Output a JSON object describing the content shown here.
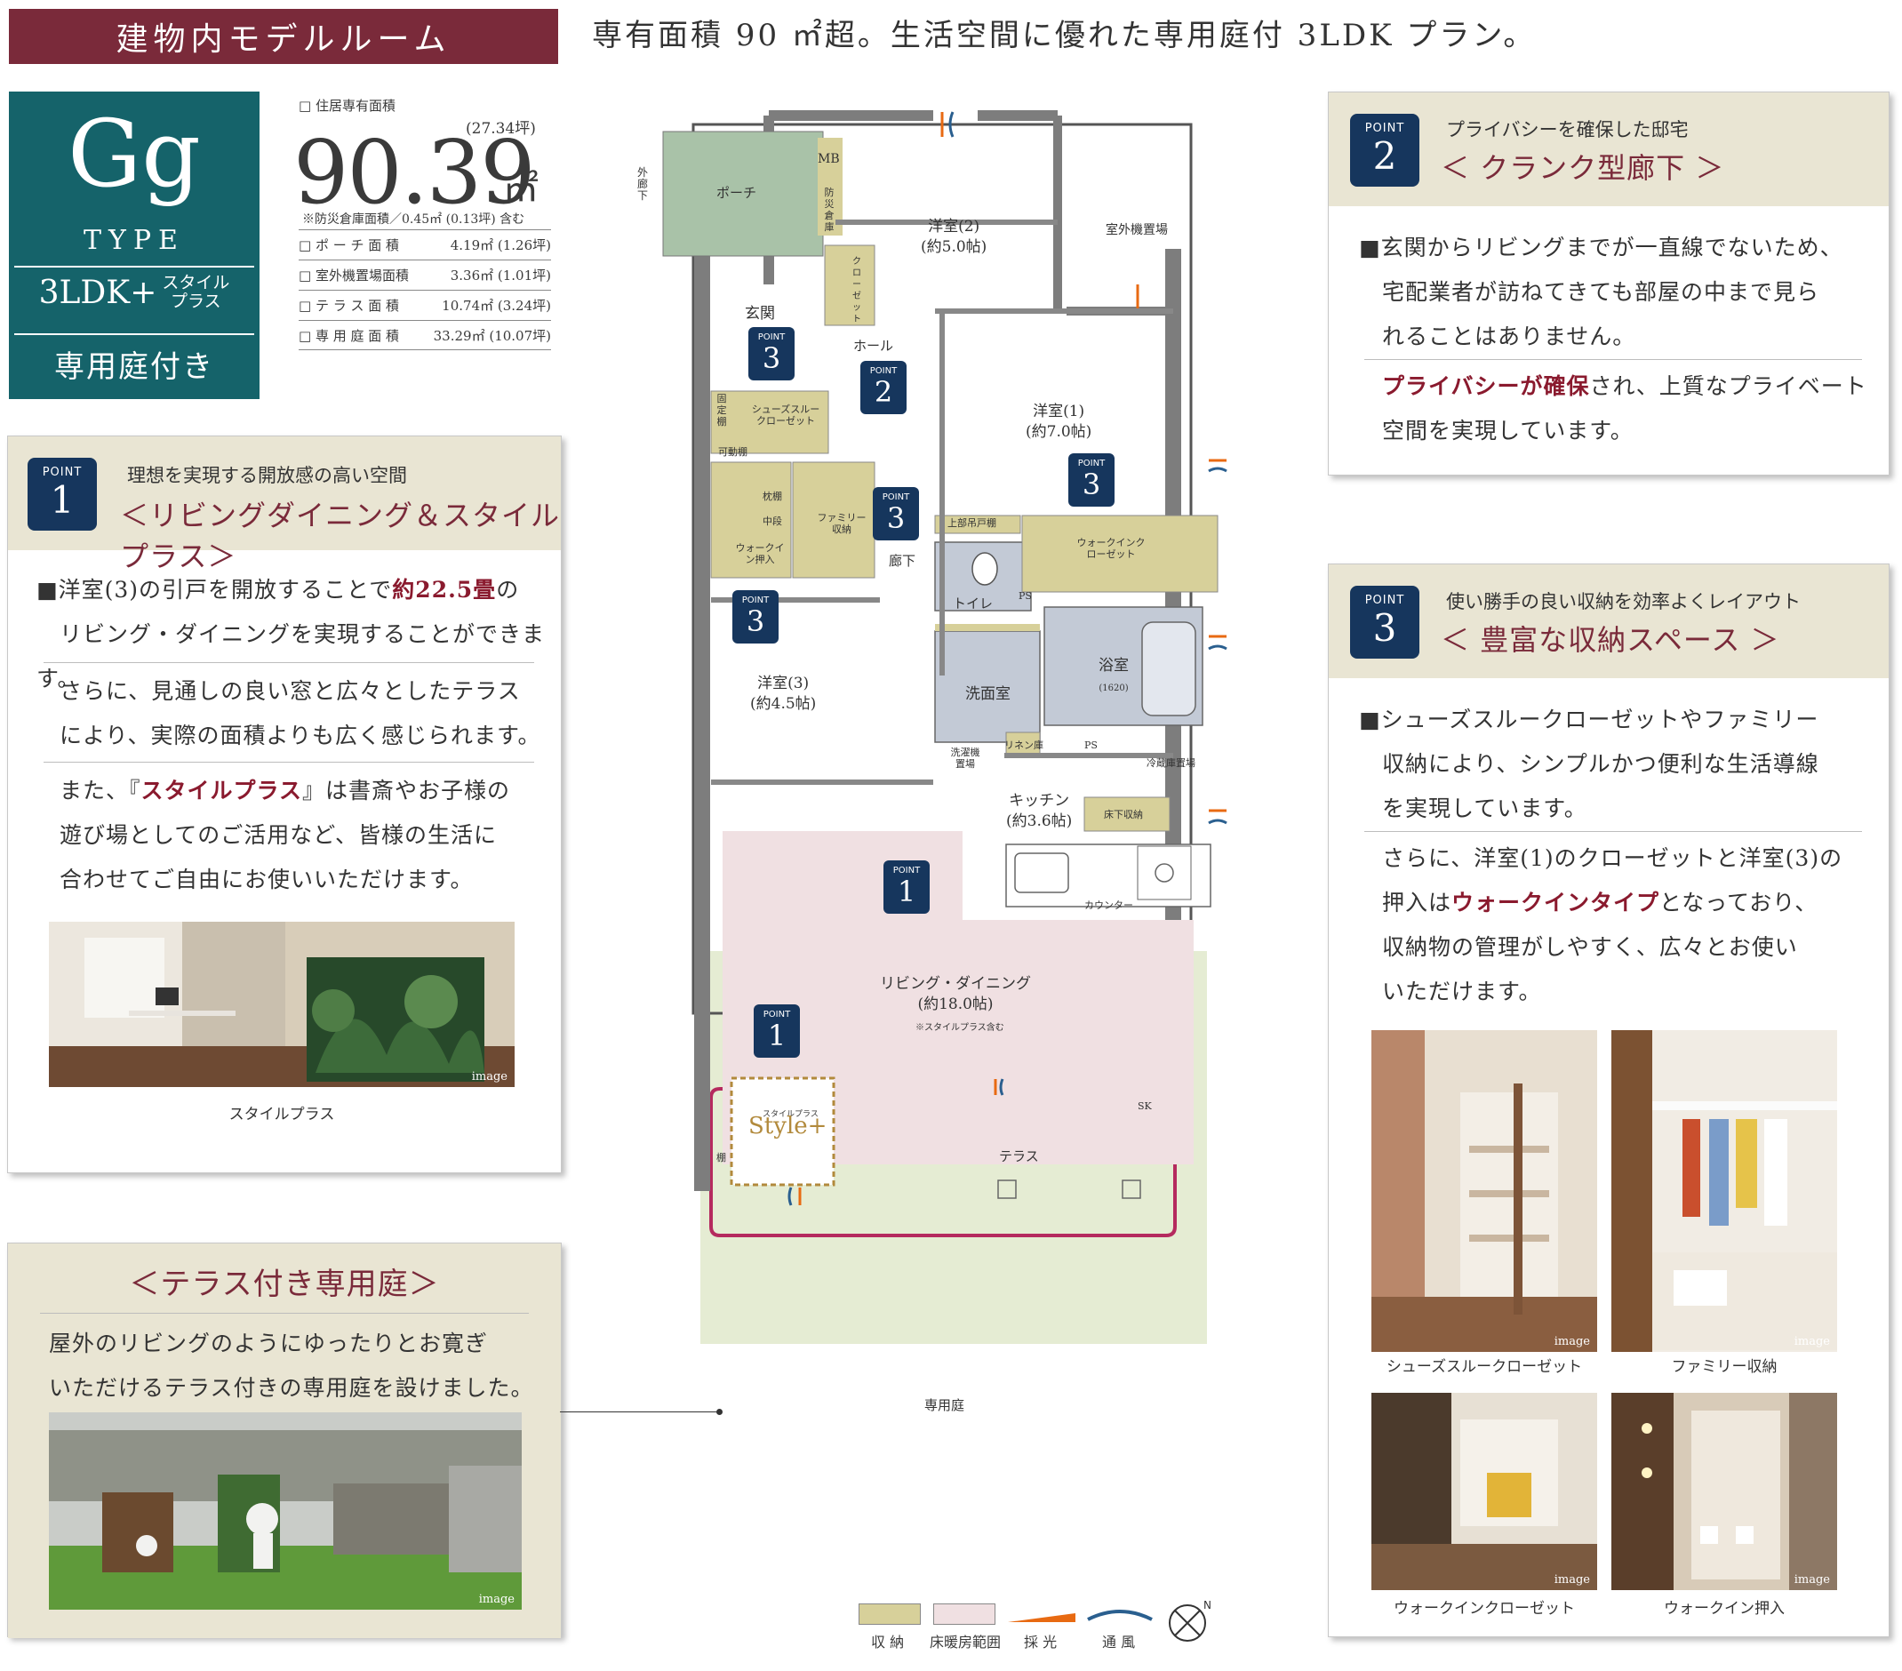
{
  "header": {
    "tag": "建物内モデルルーム",
    "title": "専有面積 90 ㎡超。生活空間に優れた専用庭付 3LDK プラン。"
  },
  "type_block": {
    "code": "Gg",
    "word": "TYPE",
    "layout": "3LDK+",
    "style_plus_1": "スタイル",
    "style_plus_2": "プラス",
    "garden": "専用庭付き"
  },
  "area": {
    "caption": "□ 住居専有面積",
    "tsubo": "(27.34坪)",
    "value": "90.39",
    "unit": "㎡",
    "note": "※防災倉庫面積／0.45㎡ (0.13坪) 含む",
    "rows": [
      {
        "label": "□ ポ ー チ 面 積",
        "value": "4.19㎡ (1.26坪)"
      },
      {
        "label": "□ 室外機置場面積",
        "value": "3.36㎡ (1.01坪)"
      },
      {
        "label": "□ テ ラ ス 面 積",
        "value": "10.74㎡ (3.24坪)"
      },
      {
        "label": "□ 専 用 庭 面 積",
        "value": "33.29㎡ (10.07坪)"
      }
    ]
  },
  "point1": {
    "badge_word": "POINT",
    "badge_num": "1",
    "subtitle": "理想を実現する開放感の高い空間",
    "title": "＜リビングダイニング＆スタイルプラス＞",
    "p1_a": "■洋室(3)の引戸を開放することで",
    "p1_hl": "約22.5畳",
    "p1_b": "の",
    "p1_c": "リビング・ダイニングを実現することができます。",
    "p2_a": "さらに、見通しの良い窓と広々としたテラス",
    "p2_b": "により、実際の面積よりも広く感じられます。",
    "p3_a": "また、『",
    "p3_hl": "スタイルプラス",
    "p3_b": "』は書斎やお子様の",
    "p3_c": "遊び場としてのご活用など、皆様の生活に",
    "p3_d": "合わせてご自由にお使いいただけます。",
    "photo_tag": "image",
    "photo_caption": "スタイルプラス"
  },
  "garden_card": {
    "title": "＜テラス付き専用庭＞",
    "text_a": "屋外のリビングのようにゆったりとお寛ぎ",
    "text_b": "いただけるテラス付きの専用庭を設けました。",
    "photo_tag": "image"
  },
  "point2": {
    "badge_word": "POINT",
    "badge_num": "2",
    "subtitle": "プライバシーを確保した邸宅",
    "title": "＜ クランク型廊下 ＞",
    "p1_a": "■玄関からリビングまでが一直線でないため、",
    "p1_b": "宅配業者が訪ねてきても部屋の中まで見ら",
    "p1_c": "れることはありません。",
    "p2_hl": "プライバシーが確保",
    "p2_a": "され、上質なプライベート",
    "p2_b": "空間を実現しています。"
  },
  "point3": {
    "badge_word": "POINT",
    "badge_num": "3",
    "subtitle": "使い勝手の良い収納を効率よくレイアウト",
    "title": "＜ 豊富な収納スペース ＞",
    "p1_a": "■シューズスルークローゼットやファミリー",
    "p1_b": "収納により、シンプルかつ便利な生活導線",
    "p1_c": "を実現しています。",
    "p2_a": "さらに、洋室(1)のクローゼットと洋室(3)の",
    "p2_b1": "押入は",
    "p2_hl": "ウォークインタイプ",
    "p2_b2": "となっており、",
    "p2_c": "収納物の管理がしやすく、広々とお使い",
    "p2_d": "いただけます。",
    "photos": [
      {
        "tag": "image",
        "caption": "シューズスルークローゼット"
      },
      {
        "tag": "image",
        "caption": "ファミリー収納"
      },
      {
        "tag": "image",
        "caption": "ウォークインクローゼット"
      },
      {
        "tag": "image",
        "caption": "ウォークイン押入"
      }
    ]
  },
  "plan": {
    "labels": {
      "outer_corridor": "外廊下",
      "porch": "ポーチ",
      "mb": "MB",
      "storage_disaster": "防災倉庫",
      "closet": "クローゼット",
      "room2": "洋室(2)",
      "room2_size": "(約5.0帖)",
      "ac_area": "室外機置場",
      "entrance": "玄関",
      "hall": "ホール",
      "room1": "洋室(1)",
      "room1_size": "(約7.0帖)",
      "shoes": "シューズスルークローゼット",
      "fixed": "固定棚",
      "movable": "可動棚",
      "pillow": "枕棚",
      "middle": "中段",
      "walkin_oshiire": "ウォークイン押入",
      "family": "ファミリー収納",
      "upper_cab": "上部吊戸棚",
      "walkin_closet": "ウォークインクローゼット",
      "corridor": "廊下",
      "toilet": "トイレ",
      "ps": "PS",
      "room3": "洋室(3)",
      "room3_size": "(約4.5帖)",
      "washroom": "洗面室",
      "bath": "浴室",
      "bath_size": "(1620)",
      "washer": "洗濯機置場",
      "linen": "リネン庫",
      "fridge": "冷蔵庫置場",
      "kitchen": "キッチン",
      "kitchen_size": "(約3.6帖)",
      "floor_storage": "床下収納",
      "counter": "カウンター",
      "ld": "リビング・ダイニング",
      "ld_size": "(約18.0帖)",
      "ld_note": "※スタイルプラス含む",
      "style_plus_small": "スタイルプラス",
      "style_plus": "Style+",
      "shelf": "棚",
      "sk": "SK",
      "terrace": "テラス",
      "garden": "専用庭"
    },
    "badges": [
      "3",
      "2",
      "3",
      "3",
      "3",
      "1",
      "1"
    ],
    "badge_word": "POINT"
  },
  "legend": {
    "storage": "収 納",
    "floor_heat": "床暖房範囲",
    "light": "採 光",
    "wind": "通 風"
  },
  "colors": {
    "header_maroon": "#7a2a3a",
    "type_teal": "#15636a",
    "badge_navy": "#16365d",
    "card_head_beige": "#e9e5d3",
    "storage_khaki": "#d7d09a",
    "floor_heat_pink": "#f0e0e2",
    "garden_green": "#e5ecd3",
    "porch_green": "#a9c2a8",
    "wet_blue": "#c3cad6",
    "garden_line": "#b52a5e"
  }
}
